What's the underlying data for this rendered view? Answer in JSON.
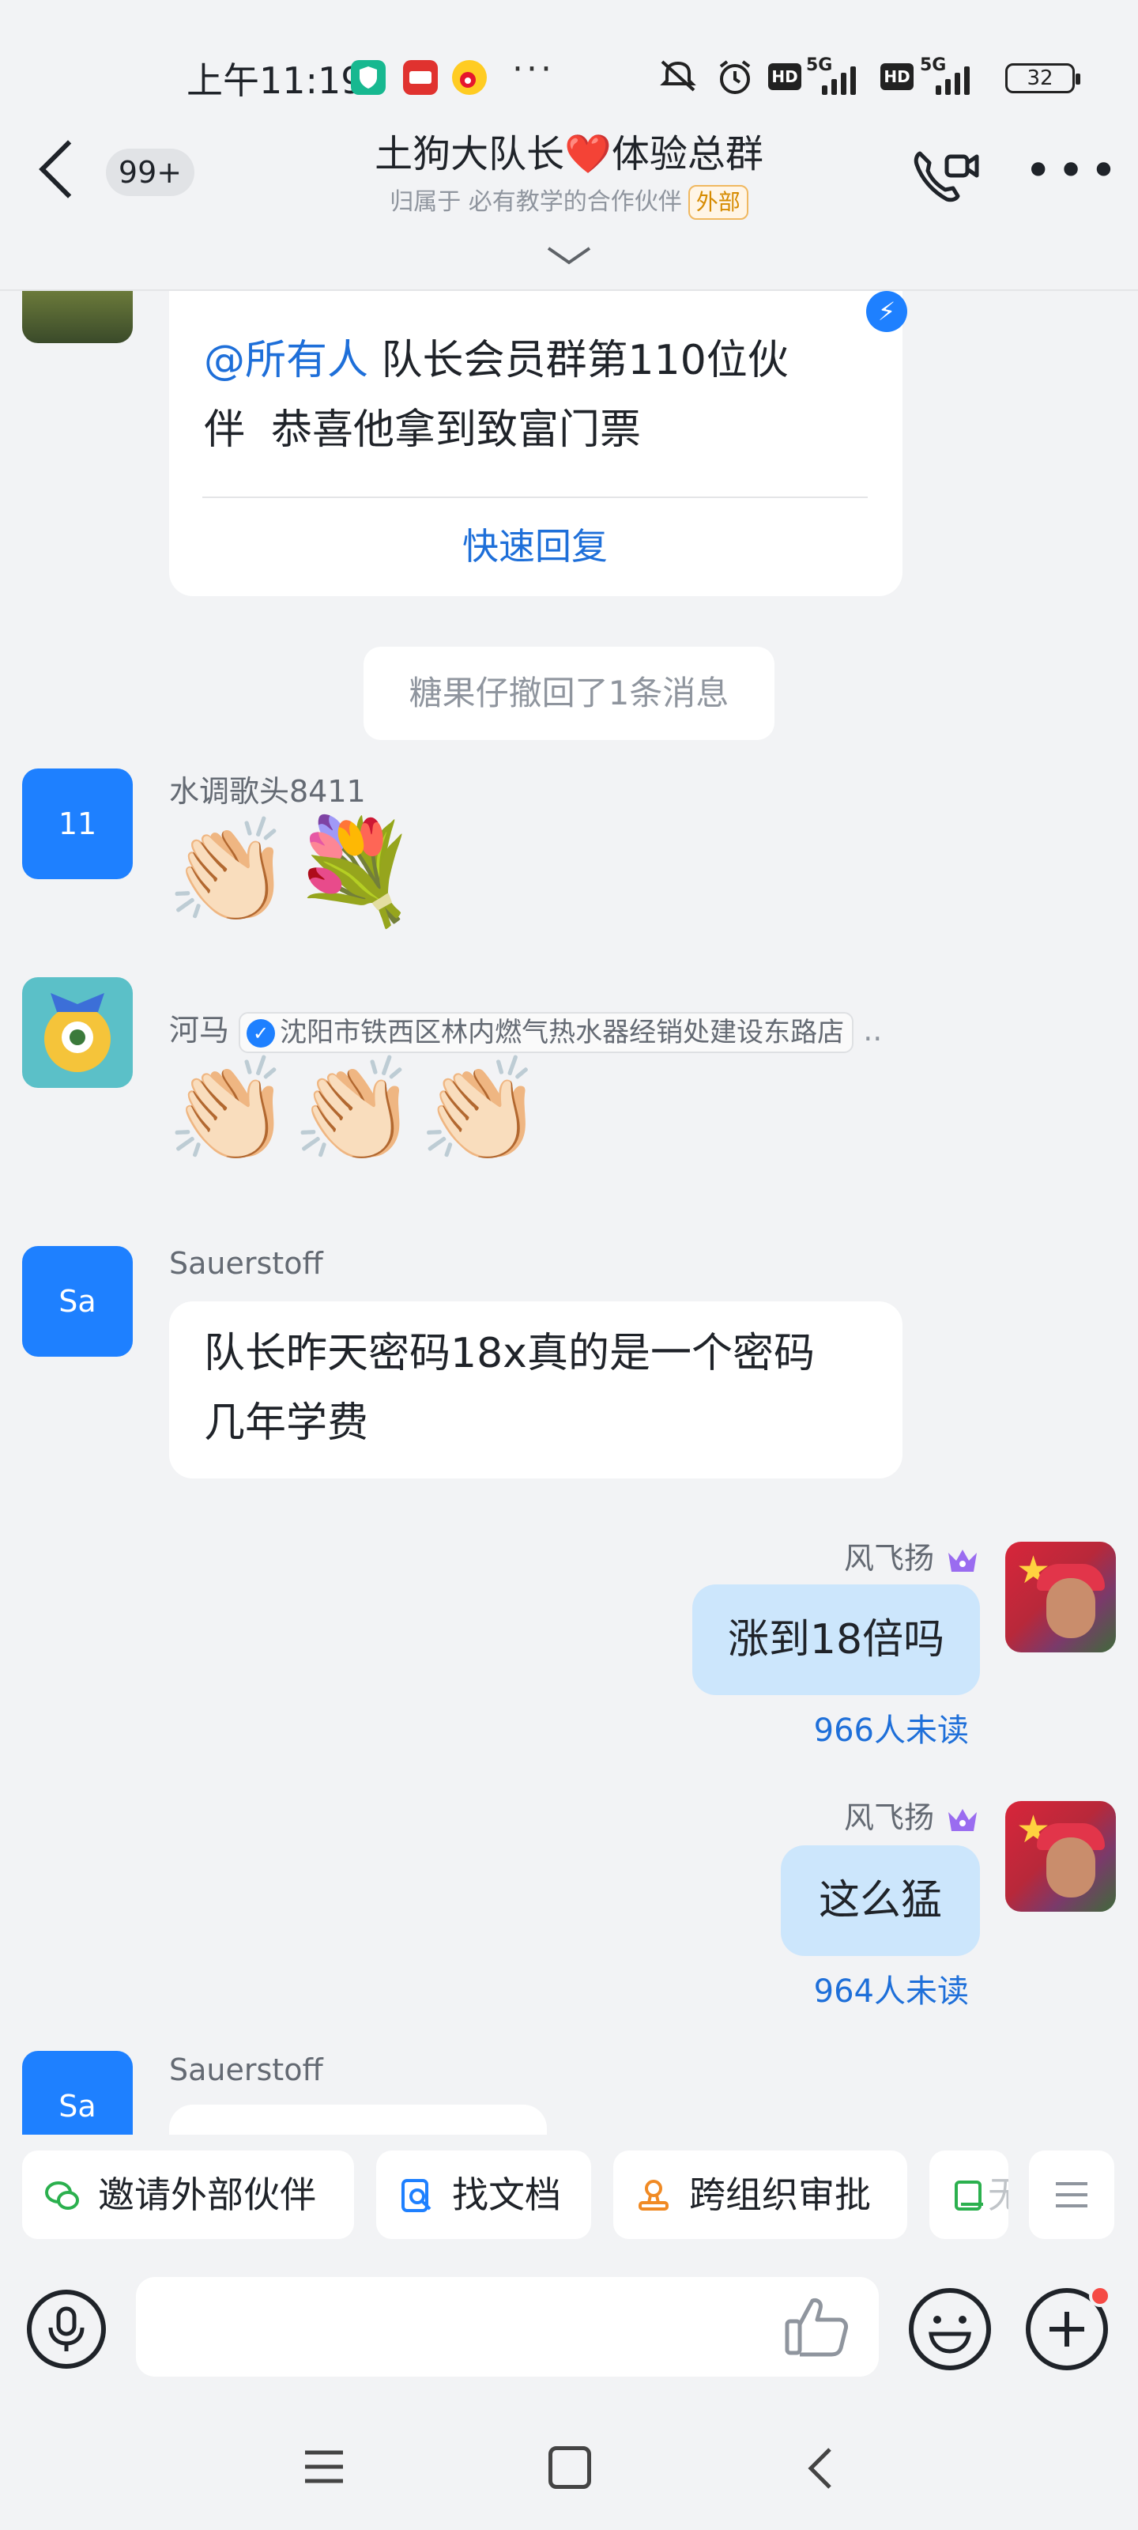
{
  "status_bar": {
    "time": "上午11:19",
    "dots": "···",
    "hd1": "HD",
    "hd2": "HD",
    "sig1": "5G",
    "sig2": "5G",
    "battery": "32"
  },
  "header": {
    "back_count": "99+",
    "title": "土狗大队长❤️体验总群",
    "subtitle": "归属于 必有教学的合作伙伴",
    "external_tag": "外部"
  },
  "messages": {
    "pinned": {
      "mention": "@所有人",
      "line1_rest": " 队长会员群第110位伙",
      "line2": "伴  恭喜他拿到致富门票",
      "quick_reply": "快速回复"
    },
    "recall": "糖果仔撤回了1条消息",
    "m1": {
      "avatar": "11",
      "name": "水调歌头8411",
      "emoji": "👏🏻💐"
    },
    "m2": {
      "name": "河马",
      "tag": "沈阳市铁西区林内燃气热水器经销处建设东路店",
      "tag_more": "..",
      "emoji": "👏🏻👏🏻👏🏻"
    },
    "m3": {
      "avatar": "Sa",
      "name": "Sauerstoff",
      "line1": "队长昨天密码18x真的是一个密码",
      "line2": "几年学费"
    },
    "m4": {
      "name": "风飞扬",
      "text": "涨到18倍吗",
      "unread": "966人未读"
    },
    "m5": {
      "name": "风飞扬",
      "text": "这么猛",
      "unread": "964人未读"
    },
    "m6": {
      "avatar": "Sa",
      "name": "Sauerstoff"
    }
  },
  "quick_actions": {
    "invite": "邀请外部伙伴",
    "find_doc": "找文档",
    "approval": "跨组织审批",
    "partial": "无"
  },
  "colors": {
    "accent": "#1e80ff",
    "link": "#1e6fd9",
    "my_bubble": "#cce6fc",
    "background": "#f2f3f5"
  }
}
